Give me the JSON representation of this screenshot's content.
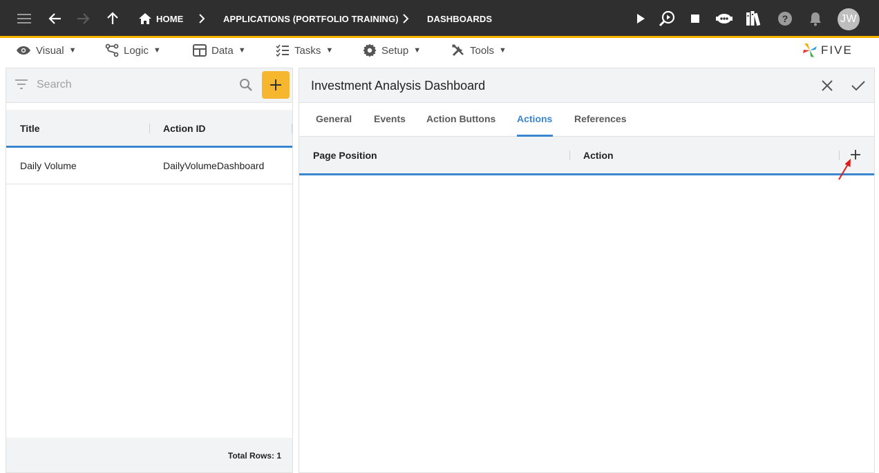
{
  "topbar": {
    "breadcrumbs": [
      {
        "label": "HOME"
      },
      {
        "label": "APPLICATIONS (PORTFOLIO TRAINING)"
      },
      {
        "label": "DASHBOARDS"
      }
    ],
    "avatar_initials": "JW"
  },
  "menu": {
    "items": [
      {
        "label": "Visual",
        "icon": "eye-icon"
      },
      {
        "label": "Logic",
        "icon": "logic-icon"
      },
      {
        "label": "Data",
        "icon": "table-icon"
      },
      {
        "label": "Tasks",
        "icon": "tasks-icon"
      },
      {
        "label": "Setup",
        "icon": "gear-icon"
      },
      {
        "label": "Tools",
        "icon": "tools-icon"
      }
    ],
    "logo_text": "FIVE"
  },
  "left_panel": {
    "search_placeholder": "Search",
    "columns": [
      "Title",
      "Action ID"
    ],
    "rows": [
      {
        "title": "Daily Volume",
        "action_id": "DailyVolumeDashboard"
      }
    ],
    "footer": "Total Rows: 1"
  },
  "right_panel": {
    "title": "Investment Analysis Dashboard",
    "tabs": [
      {
        "label": "General",
        "active": false
      },
      {
        "label": "Events",
        "active": false
      },
      {
        "label": "Action Buttons",
        "active": false
      },
      {
        "label": "Actions",
        "active": true
      },
      {
        "label": "References",
        "active": false
      }
    ],
    "grid_columns": [
      "Page Position",
      "Action"
    ]
  },
  "colors": {
    "topbar_bg": "#2f2f2f",
    "accent": "#f5b300",
    "add_button": "#f6b72f",
    "link_blue": "#3a86d0",
    "annotation_arrow": "#e01b1b"
  }
}
